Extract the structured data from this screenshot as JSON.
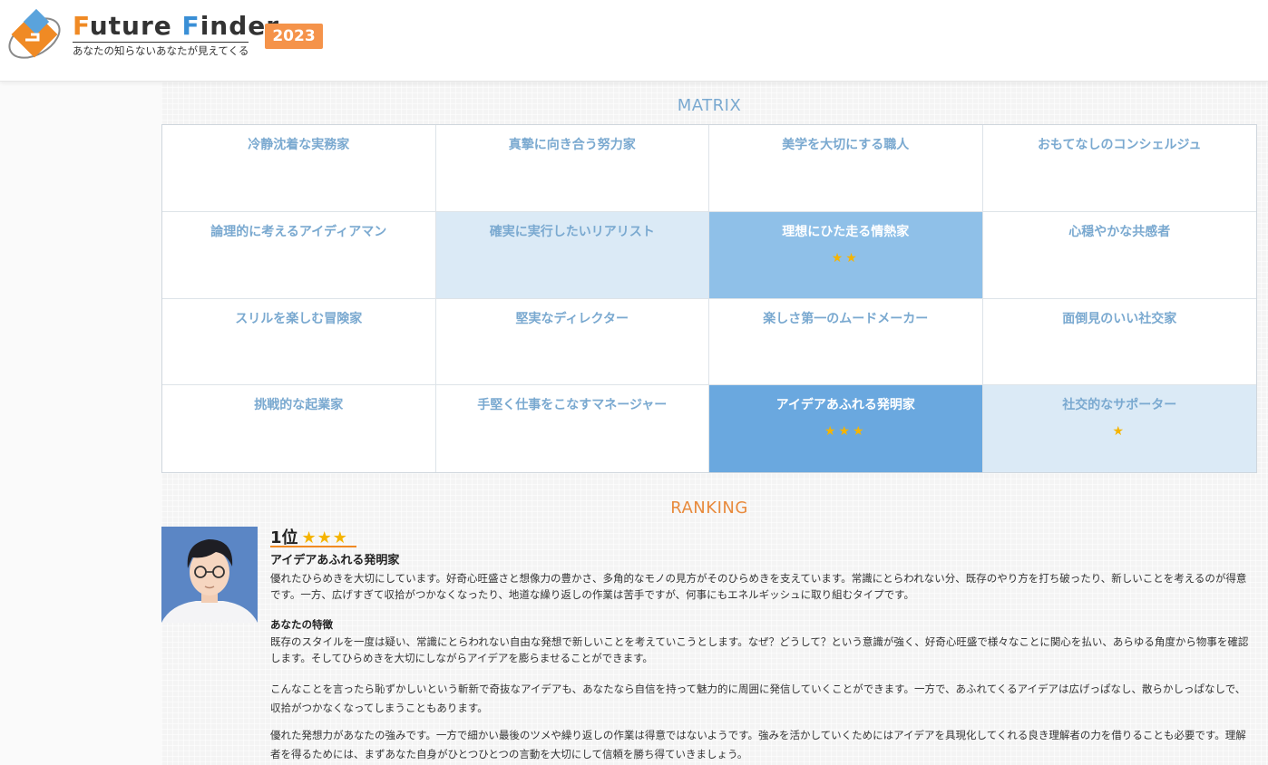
{
  "header": {
    "logo_text": "Future Finder",
    "logo_f1": "F",
    "logo_rest1": "uture ",
    "logo_f2": "F",
    "logo_rest2": "inder",
    "tagline": "あなたの知らないあなたが見えてくる",
    "year": "2023"
  },
  "matrix": {
    "title": "MATRIX",
    "cells": [
      {
        "label": "冷静沈着な実務家",
        "stars": ""
      },
      {
        "label": "真摯に向き合う努力家",
        "stars": ""
      },
      {
        "label": "美学を大切にする職人",
        "stars": ""
      },
      {
        "label": "おもてなしのコンシェルジュ",
        "stars": ""
      },
      {
        "label": "論理的に考えるアイディアマン",
        "stars": ""
      },
      {
        "label": "確実に実行したいリアリスト",
        "stars": ""
      },
      {
        "label": "理想にひた走る情熱家",
        "stars": "★★"
      },
      {
        "label": "心穏やかな共感者",
        "stars": ""
      },
      {
        "label": "スリルを楽しむ冒険家",
        "stars": ""
      },
      {
        "label": "堅実なディレクター",
        "stars": ""
      },
      {
        "label": "楽しさ第一のムードメーカー",
        "stars": ""
      },
      {
        "label": "面倒見のいい社交家",
        "stars": ""
      },
      {
        "label": "挑戦的な起業家",
        "stars": ""
      },
      {
        "label": "手堅く仕事をこなすマネージャー",
        "stars": ""
      },
      {
        "label": "アイデアあふれる発明家",
        "stars": "★★★"
      },
      {
        "label": "社交的なサポーター",
        "stars": "★"
      }
    ]
  },
  "ranking": {
    "title": "RANKING",
    "rank_label": "1位",
    "rank_stars": "★★★",
    "type_name": "アイデアあふれる発明家",
    "intro": "優れたひらめきを大切にしています。好奇心旺盛さと想像力の豊かさ、多角的なモノの見方がそのひらめきを支えています。常識にとらわれない分、既存のやり方を打ち破ったり、新しいことを考えるのが得意です。一方、広げすぎて収拾がつかなくなったり、地道な繰り返しの作業は苦手ですが、何事にもエネルギッシュに取り組むタイプです。",
    "feature_heading": "あなたの特徴",
    "paragraphs": [
      "既存のスタイルを一度は疑い、常識にとらわれない自由な発想で新しいことを考えていこうとします。なぜ？どうして？という意識が強く、好奇心旺盛で様々なことに関心を払い、あらゆる角度から物事を確認します。そしてひらめきを大切にしながらアイデアを膨らませることができます。",
      "こんなことを言ったら恥ずかしいという斬新で奇抜なアイデアも、あなたなら自信を持って魅力的に周囲に発信していくことができます。一方で、あふれてくるアイデアは広げっぱなし、散らかしっぱなしで、収拾がつかなくなってしまうこともあります。",
      "優れた発想力があなたの強みです。一方で細かい最後のツメや繰り返しの作業は得意ではないようです。強みを活かしていくためにはアイデアを具現化してくれる良き理解者の力を借りることも必要です。理解者を得るためには、まずあなた自身がひとつひとつの言動を大切にして信頼を勝ち得ていきましょう。"
    ]
  },
  "colors": {
    "accent_orange": "#f08a24",
    "year_badge": "#f5934a",
    "matrix_text": "#7aa9d0",
    "level1": "#dbeaf6",
    "level2": "#8fc0e8",
    "level3": "#6aa8df",
    "star": "#f5b400"
  }
}
